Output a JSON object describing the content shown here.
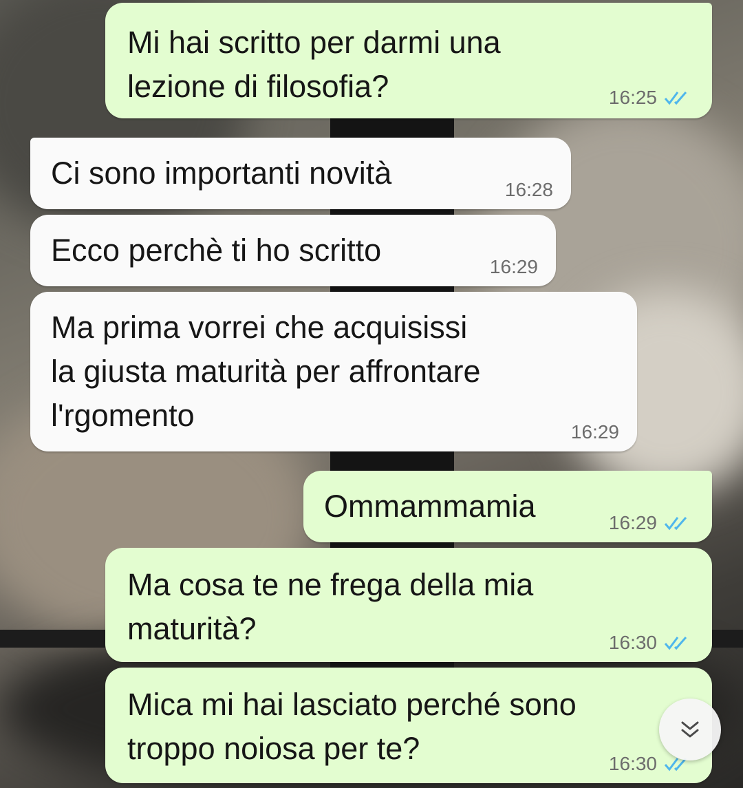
{
  "chat": {
    "accent_read_ticks": "#4fb6ec",
    "outgoing_bubble_color": "#e3fdd0",
    "incoming_bubble_color": "#fafafa",
    "messages": [
      {
        "direction": "outgoing",
        "text": "Mi hai scritto per darmi una\nlezione di filosofia?",
        "time": "16:25",
        "status": "read"
      },
      {
        "direction": "incoming",
        "text": "Ci sono importanti novità",
        "time": "16:28"
      },
      {
        "direction": "incoming",
        "text": "Ecco perchè ti ho scritto",
        "time": "16:29"
      },
      {
        "direction": "incoming",
        "text": "Ma prima vorrei che acquisissi\nla giusta maturità per affrontare\nl'rgomento",
        "time": "16:29"
      },
      {
        "direction": "outgoing",
        "text": "Ommammamia",
        "time": "16:29",
        "status": "read"
      },
      {
        "direction": "outgoing",
        "text": "Ma cosa te ne frega della mia\nmaturità?",
        "time": "16:30",
        "status": "read"
      },
      {
        "direction": "outgoing",
        "text": "Mica mi hai lasciato perché sono\ntroppo noiosa per te?",
        "time": "16:30",
        "status": "read"
      }
    ]
  },
  "scroll_button": {
    "icon": "double-chevron-down-icon"
  }
}
